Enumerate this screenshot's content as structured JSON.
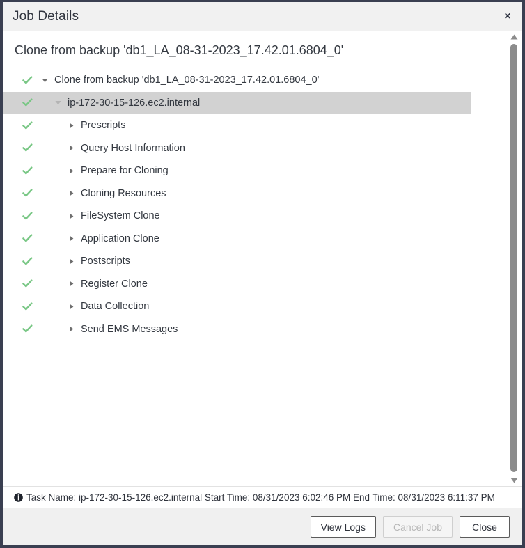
{
  "window": {
    "title": "Job Details",
    "close_label": "×"
  },
  "job": {
    "heading": "Clone from backup 'db1_LA_08-31-2023_17.42.01.6804_0'"
  },
  "tree": {
    "nodes": [
      {
        "label": "Clone from backup 'db1_LA_08-31-2023_17.42.01.6804_0'",
        "level": 0,
        "status": "success",
        "twisty": "expanded",
        "selected": false
      },
      {
        "label": "ip-172-30-15-126.ec2.internal",
        "level": 1,
        "status": "success",
        "twisty": "expanded",
        "selected": true
      },
      {
        "label": "Prescripts",
        "level": 2,
        "status": "success",
        "twisty": "collapsed",
        "selected": false
      },
      {
        "label": "Query Host Information",
        "level": 2,
        "status": "success",
        "twisty": "collapsed",
        "selected": false
      },
      {
        "label": "Prepare for Cloning",
        "level": 2,
        "status": "success",
        "twisty": "collapsed",
        "selected": false
      },
      {
        "label": "Cloning Resources",
        "level": 2,
        "status": "success",
        "twisty": "collapsed",
        "selected": false
      },
      {
        "label": "FileSystem Clone",
        "level": 2,
        "status": "success",
        "twisty": "collapsed",
        "selected": false
      },
      {
        "label": "Application Clone",
        "level": 2,
        "status": "success",
        "twisty": "collapsed",
        "selected": false
      },
      {
        "label": "Postscripts",
        "level": 2,
        "status": "success",
        "twisty": "collapsed",
        "selected": false
      },
      {
        "label": "Register Clone",
        "level": 2,
        "status": "success",
        "twisty": "collapsed",
        "selected": false
      },
      {
        "label": "Data Collection",
        "level": 2,
        "status": "success",
        "twisty": "collapsed",
        "selected": false
      },
      {
        "label": "Send EMS Messages",
        "level": 2,
        "status": "success",
        "twisty": "collapsed",
        "selected": false
      }
    ]
  },
  "statusbar": {
    "icon": "info-icon",
    "text": "Task Name: ip-172-30-15-126.ec2.internal Start Time: 08/31/2023 6:02:46 PM End Time: 08/31/2023 6:11:37 PM"
  },
  "footer": {
    "view_logs_label": "View Logs",
    "cancel_job_label": "Cancel Job",
    "close_label": "Close",
    "cancel_job_disabled": true
  },
  "scrollbar": {
    "up_arrow": "scroll-up-icon",
    "down_arrow": "scroll-down-icon"
  },
  "colors": {
    "window_border": "#3a3f51",
    "titlebar_bg": "#f1f1f1",
    "success_check": "#79c785",
    "selected_row": "#d2d2d2",
    "footer_bg": "#f0f0f0",
    "text": "#333840"
  }
}
